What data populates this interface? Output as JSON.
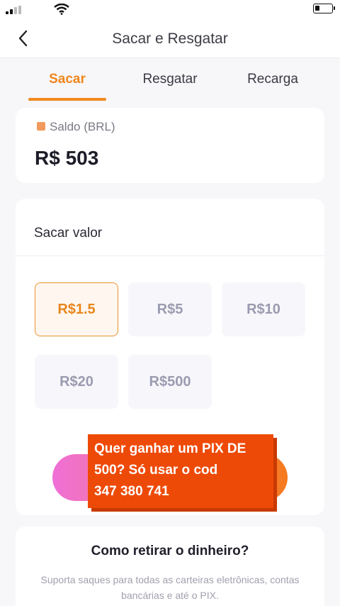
{
  "header": {
    "title": "Sacar e Resgatar"
  },
  "tabs": [
    {
      "label": "Sacar",
      "active": true
    },
    {
      "label": "Resgatar",
      "active": false
    },
    {
      "label": "Recarga",
      "active": false
    }
  ],
  "balance": {
    "label": "Saldo (BRL)",
    "value": "R$ 503"
  },
  "withdraw": {
    "title": "Sacar valor",
    "amounts": [
      "R$1.5",
      "R$5",
      "R$10",
      "R$20",
      "R$500"
    ],
    "selected": "R$1.5"
  },
  "promo": {
    "line1": "Quer ganhar um PIX DE",
    "line2": "500? Só usar o cod",
    "line3": "347 380 741"
  },
  "info": {
    "title": "Como retirar o dinheiro?",
    "text": "Suporta saques para todas as carteiras eletrônicas, contas bancárias e até o PIX."
  },
  "colors": {
    "accent": "#f0861e",
    "promo": "#ee4a07"
  },
  "icons": {
    "back": "chevron-left-icon",
    "coin": "coin-icon"
  }
}
